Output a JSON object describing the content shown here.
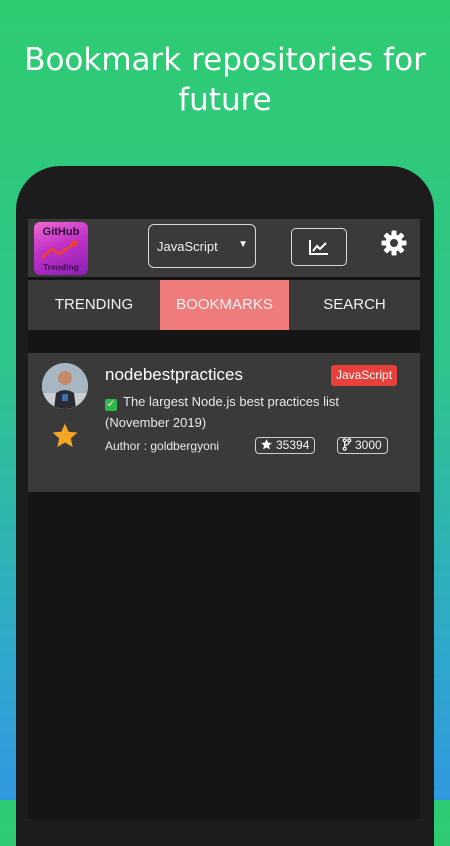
{
  "headline": {
    "line1": "Bookmark repositories for",
    "line2": "future"
  },
  "app_logo": {
    "top_text": "GitHub",
    "bottom_text": "Trending"
  },
  "language_select": {
    "value": "JavaScript"
  },
  "tabs": [
    {
      "label": "TRENDING",
      "active": false
    },
    {
      "label": "BOOKMARKS",
      "active": true
    },
    {
      "label": "SEARCH",
      "active": false
    }
  ],
  "repo": {
    "name": "nodebestpractices",
    "language": "JavaScript",
    "language_color": "#e8403a",
    "description_line1": "The largest Node.js best practices list",
    "description_line2": "(November 2019)",
    "author": "Author : goldbergyoni",
    "stars": "35394",
    "forks": "3000"
  },
  "colors": {
    "accent_tab": "#f07b7b",
    "bookmark_star": "#f5a623"
  }
}
